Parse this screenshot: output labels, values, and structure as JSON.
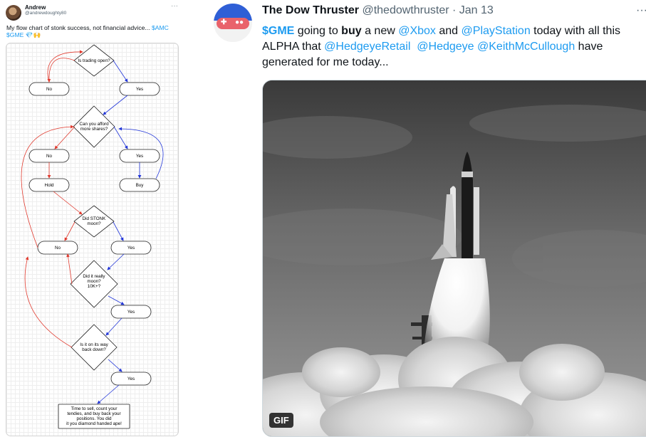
{
  "left_tweet": {
    "author_name": "Andrew",
    "author_handle": "@andrewdoughty80",
    "more_glyph": "···",
    "text_plain": "My flow chart of stonk success, not financial advice...",
    "text_tags": "$AMC $GME",
    "text_emoji": "💎🙌",
    "flowchart": {
      "decisions": [
        "Is trading open?",
        "Can you afford\nmore shares?",
        "Did STONK\nmoon?",
        "Did it really\nmoon?\n10K+?",
        "Is it on its way\nback down?"
      ],
      "no_1": "No",
      "yes_1": "Yes",
      "no_2": "No",
      "yes_2": "Yes",
      "hold": "Hold",
      "buy": "Buy",
      "no_3": "No",
      "yes_3": "Yes",
      "yes_4": "Yes",
      "yes_5": "Yes",
      "final": "Time to sell, count your\ntendies, and buy back your\npositions. You did\nit you diamond handed ape!"
    }
  },
  "right_tweet": {
    "author_name": "The Dow Thruster",
    "author_handle": "@thedowthruster",
    "separator": " · ",
    "date": "Jan 13",
    "more_glyph": "···",
    "cashtag": "$GME",
    "t1": " going to ",
    "t_bold": "buy",
    "t2": " a new ",
    "m_xbox": "@Xbox",
    "t3": " and ",
    "m_ps": "@PlayStation",
    "t4": " today with all this ALPHA that ",
    "m_hr": "@HedgeyeRetail",
    "t5": "  ",
    "m_h": "@Hedgeye",
    "t6": " ",
    "m_km": "@KeithMcCullough",
    "t7": " have generated for me today...",
    "media_badge": "GIF"
  },
  "colors": {
    "link": "#1d9bf0",
    "arrow_red": "#e0392d",
    "arrow_blue": "#2236d8"
  }
}
